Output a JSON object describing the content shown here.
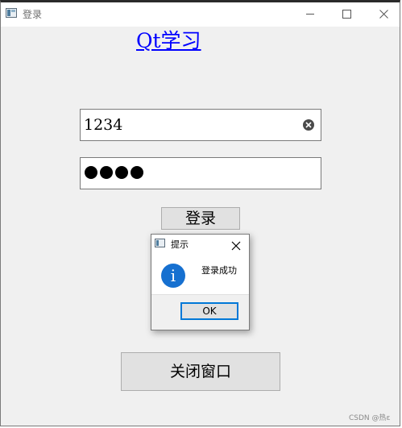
{
  "window": {
    "title": "登录"
  },
  "main": {
    "heading": "Qt学习",
    "username_value": "1234",
    "password_mask_count": 4,
    "login_button": "登录",
    "close_window_button": "关闭窗口"
  },
  "message_box": {
    "title": "提示",
    "text": "登录成功",
    "ok_button": "OK",
    "icon": "info-icon"
  },
  "watermark": "CSDN @热ε",
  "colors": {
    "link": "#0000ff",
    "focus_border": "#0078d7",
    "info_icon": "#1670d0"
  }
}
